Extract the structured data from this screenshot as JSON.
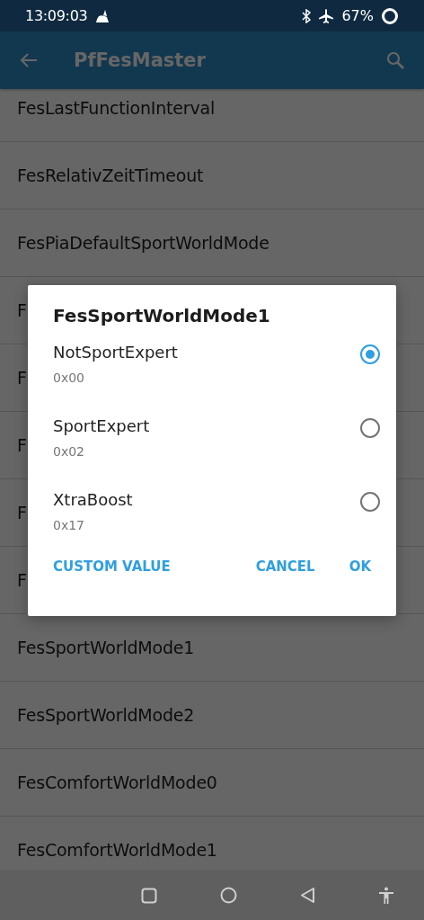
{
  "status_bar": {
    "time": "13:09:03",
    "battery": "67%"
  },
  "app_bar": {
    "title": "PfFesMaster"
  },
  "list": [
    "FesLastFunctionInterval",
    "FesRelativZeitTimeout",
    "FesPiaDefaultSportWorldMode",
    "F",
    "F",
    "F",
    "F",
    "F",
    "FesSportWorldMode1",
    "FesSportWorldMode2",
    "FesComfortWorldMode0",
    "FesComfortWorldMode1"
  ],
  "dialog": {
    "title": "FesSportWorldMode1",
    "options": [
      {
        "label": "NotSportExpert",
        "value": "0x00",
        "selected": true
      },
      {
        "label": "SportExpert",
        "value": "0x02",
        "selected": false
      },
      {
        "label": "XtraBoost",
        "value": "0x17",
        "selected": false
      }
    ],
    "buttons": {
      "neutral": "CUSTOM VALUE",
      "negative": "CANCEL",
      "positive": "OK"
    }
  }
}
